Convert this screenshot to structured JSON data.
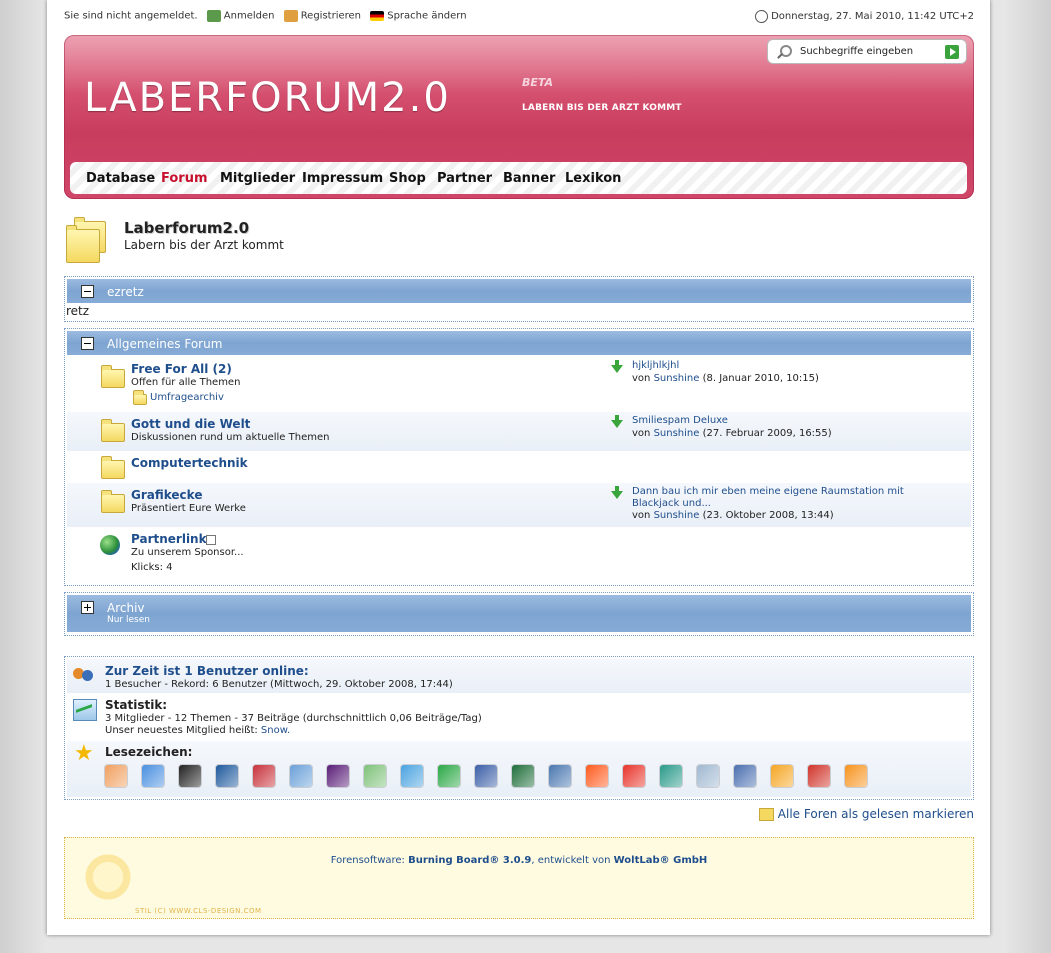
{
  "topbar": {
    "not_logged_in": "Sie sind nicht angemeldet.",
    "login": "Anmelden",
    "register": "Registrieren",
    "language": "Sprache ändern",
    "datetime": "Donnerstag, 27. Mai 2010, 11:42 UTC+2"
  },
  "header": {
    "logo": "LABERFORUM2.0",
    "beta": "BETA",
    "slogan": "LABERN BIS DER ARZT KOMMT",
    "search_placeholder": "Suchbegriffe eingeben"
  },
  "nav": [
    "Database",
    "Forum",
    "Mitglieder",
    "Impressum",
    "Shop",
    "Partner",
    "Banner",
    "Lexikon"
  ],
  "nav_active": "Forum",
  "page": {
    "title": "Laberforum2.0",
    "subtitle": "Labern bis der Arzt kommt"
  },
  "category_ezretz": {
    "title": "ezretz",
    "body": "retz"
  },
  "category_general": {
    "title": "Allgemeines Forum",
    "boards": [
      {
        "name": "Free For All (2)",
        "desc": "Offen für alle Themen",
        "sub": "Umfragearchiv",
        "last_title": "hjkljhlkjhl",
        "by": "von",
        "last_user": "Sunshine",
        "last_date": "(8. Januar 2010, 10:15)"
      },
      {
        "name": "Gott und die Welt",
        "desc": "Diskussionen rund um aktuelle Themen",
        "last_title": "Smiliespam Deluxe",
        "by": "von",
        "last_user": "Sunshine",
        "last_date": "(27. Februar 2009, 16:55)"
      },
      {
        "name": "Computertechnik"
      },
      {
        "name": "Grafikecke",
        "desc": "Präsentiert Eure Werke",
        "last_title_1": "Dann bau ich mir eben meine eigene Raumstation mit",
        "last_title_2": "Blackjack und...",
        "by": "von",
        "last_user": "Sunshine",
        "last_date": "(23. Oktober 2008, 13:44)"
      },
      {
        "name": "Partnerlink",
        "desc": "Zu unserem Sponsor...",
        "clicks": "Klicks: 4"
      }
    ]
  },
  "category_archive": {
    "title": "Archiv",
    "sub": "Nur lesen"
  },
  "stats": {
    "online_title": "Zur Zeit ist 1 Benutzer online:",
    "online_desc": "1 Besucher - Rekord: 6 Benutzer (Mittwoch, 29. Oktober 2008, 17:44)",
    "stat_title": "Statistik:",
    "stat_desc": "3 Mitglieder - 12 Themen - 37 Beiträge (durchschnittlich 0,06 Beiträge/Tag)",
    "newest_prefix": "Unser neuestes Mitglied heißt:",
    "newest_user": "Snow.",
    "bookmarks_title": "Lesezeichen:"
  },
  "bookmark_colors": [
    "#f0a060",
    "#4a90e0",
    "#222222",
    "#1f5a9e",
    "#c8323c",
    "#6aa0d8",
    "#5a1e78",
    "#7fc27a",
    "#4aa3e0",
    "#2aa845",
    "#3b5fa8",
    "#1e6e3a",
    "#4a78b0",
    "#ff5a1e",
    "#e8342a",
    "#2a9a8a",
    "#a0b8d0",
    "#4a6fb0",
    "#f5a623",
    "#d0342a",
    "#f7931e"
  ],
  "mark_all_read": "Alle Foren als gelesen markieren",
  "footer": {
    "prefix": "Forensoftware:",
    "software": "Burning Board® 3.0.9",
    "middle": ", entwickelt von",
    "company": "WoltLab® GmbH",
    "style": "STIL (C) WWW.CLS-DESIGN.COM"
  }
}
